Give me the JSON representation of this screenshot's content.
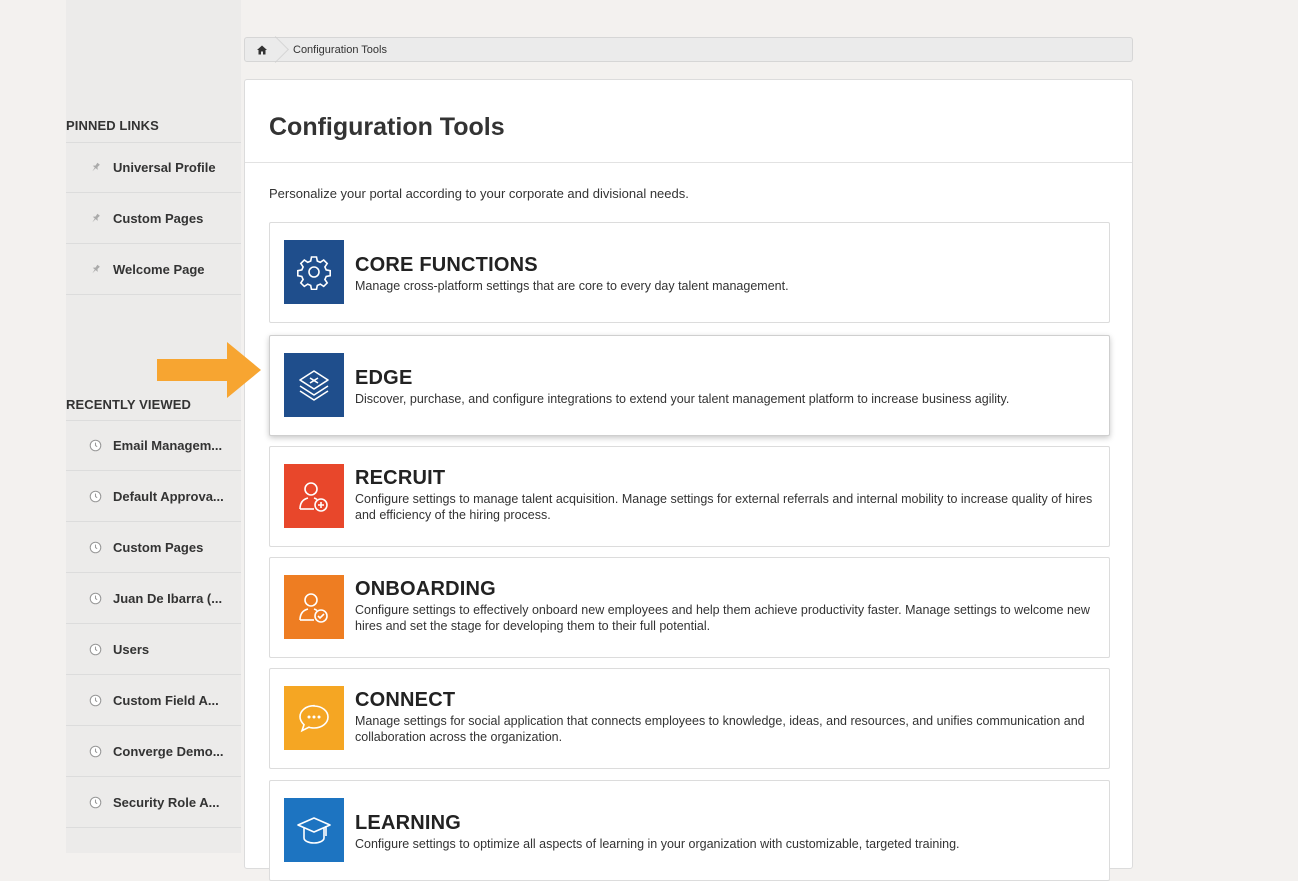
{
  "breadcrumb": {
    "home_icon": "home-icon",
    "current": "Configuration Tools"
  },
  "sidebar": {
    "pinned_header": "PINNED LINKS",
    "pinned": [
      {
        "label": "Universal Profile",
        "icon": "pin-icon"
      },
      {
        "label": "Custom Pages",
        "icon": "pin-icon"
      },
      {
        "label": "Welcome Page",
        "icon": "pin-icon"
      }
    ],
    "recent_header": "RECENTLY VIEWED",
    "recent": [
      {
        "label": "Email Managem...",
        "icon": "clock-icon"
      },
      {
        "label": "Default Approva...",
        "icon": "clock-icon"
      },
      {
        "label": "Custom Pages",
        "icon": "clock-icon"
      },
      {
        "label": "Juan De Ibarra (...",
        "icon": "clock-icon"
      },
      {
        "label": "Users",
        "icon": "clock-icon"
      },
      {
        "label": "Custom Field A...",
        "icon": "clock-icon"
      },
      {
        "label": "Converge Demo...",
        "icon": "clock-icon"
      },
      {
        "label": "Security Role A...",
        "icon": "clock-icon"
      }
    ]
  },
  "main": {
    "title": "Configuration Tools",
    "description": "Personalize your portal according to your corporate and divisional needs.",
    "cards": [
      {
        "title": "CORE FUNCTIONS",
        "description": "Manage cross-platform settings that are core to every day talent management.",
        "color": "#1f4e8c",
        "icon": "gear-icon"
      },
      {
        "title": "EDGE",
        "description": "Discover, purchase, and configure integrations to extend your talent management platform to increase business agility.",
        "color": "#1f4e8c",
        "icon": "layers-icon"
      },
      {
        "title": "RECRUIT",
        "description": "Configure settings to manage talent acquisition. Manage settings for external referrals and internal mobility to increase quality of hires and efficiency of the hiring process.",
        "color": "#e8472b",
        "icon": "person-add-icon"
      },
      {
        "title": "ONBOARDING",
        "description": "Configure settings to effectively onboard new employees and help them achieve productivity faster. Manage settings to welcome new hires and set the stage for developing them to their full potential.",
        "color": "#ee7d22",
        "icon": "person-check-icon"
      },
      {
        "title": "CONNECT",
        "description": "Manage settings for social application that connects employees to knowledge, ideas, and resources, and unifies communication and collaboration across the organization.",
        "color": "#f5a623",
        "icon": "chat-bubble-icon"
      },
      {
        "title": "LEARNING",
        "description": "Configure settings to optimize all aspects of learning in your organization with customizable, targeted training.",
        "color": "#1d74c1",
        "icon": "graduation-cap-icon"
      }
    ]
  },
  "annotation": {
    "arrow_color": "#f7a531",
    "arrow_icon": "arrow-right-icon"
  }
}
